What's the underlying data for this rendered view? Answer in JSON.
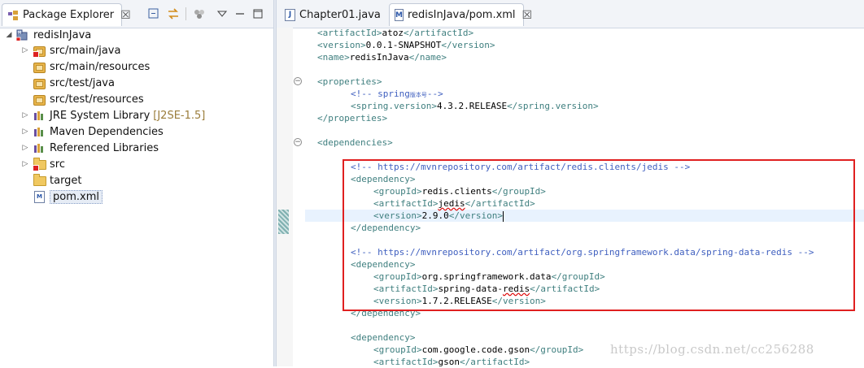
{
  "explorer": {
    "tab_label": "Package Explorer",
    "close_glyph": "☒",
    "tree": [
      {
        "label": "redisInJava",
        "icon": "project-icon"
      },
      {
        "label": "src/main/java",
        "icon": "source-folder-error-icon"
      },
      {
        "label": "src/main/resources",
        "icon": "source-folder-icon"
      },
      {
        "label": "src/test/java",
        "icon": "source-folder-icon"
      },
      {
        "label": "src/test/resources",
        "icon": "source-folder-icon"
      },
      {
        "label": "JRE System Library",
        "extra": "[J2SE-1.5]",
        "icon": "library-icon"
      },
      {
        "label": "Maven Dependencies",
        "icon": "library-icon"
      },
      {
        "label": "Referenced Libraries",
        "icon": "library-icon"
      },
      {
        "label": "src",
        "icon": "folder-error-icon"
      },
      {
        "label": "target",
        "icon": "folder-icon"
      },
      {
        "label": "pom.xml",
        "icon": "xml-file-icon"
      }
    ]
  },
  "editor": {
    "tabs": [
      {
        "label": "Chapter01.java",
        "icon": "java-file-icon"
      },
      {
        "label": "redisInJava/pom.xml",
        "icon": "maven-pom-icon"
      }
    ],
    "lines": {
      "l1": [
        "<artifactId>",
        "atoz",
        "</artifactId>"
      ],
      "l2": [
        "<version>",
        "0.0.1-SNAPSHOT",
        "</version>"
      ],
      "l3": [
        "<name>",
        "redisInJava",
        "</name>"
      ],
      "l4": "<properties>",
      "l5a": "<!-- spring",
      "l5b": "版本号",
      "l5c": "-->",
      "l6": [
        "<spring.version>",
        "4.3.2.RELEASE",
        "</spring.version>"
      ],
      "l7": "</properties>",
      "l8": "<dependencies>",
      "l9": "<!-- https://mvnrepository.com/artifact/redis.clients/jedis -->",
      "l10": "<dependency>",
      "l11": [
        "<groupId>",
        "redis.clients",
        "</groupId>"
      ],
      "l12": [
        "<artifactId>",
        "jedis",
        "</artifactId>"
      ],
      "l13": [
        "<version>",
        "2.9.0",
        "</version>"
      ],
      "l14": "</dependency>",
      "l15": "<!-- https://mvnrepository.com/artifact/org.springframework.data/spring-data-redis -->",
      "l16": "<dependency>",
      "l17": [
        "<groupId>",
        "org.springframework.data",
        "</groupId>"
      ],
      "l18": [
        "<artifactId>",
        "spring-data-",
        "redis",
        "</artifactId>"
      ],
      "l19": [
        "<version>",
        "1.7.2.RELEASE",
        "</version>"
      ],
      "l20": "</dependency>",
      "l21": "<dependency>",
      "l22": [
        "<groupId>",
        "com.google.code.gson",
        "</groupId>"
      ],
      "l23": [
        "<artifactId>",
        "gson",
        "</artifactId>"
      ]
    }
  },
  "watermark": "https://blog.csdn.net/cc256288",
  "colors": {
    "tag": "#3f7f7f",
    "comment": "#3f5fbf",
    "highlight_border": "#e02020",
    "current_line": "#e8f2fe"
  }
}
